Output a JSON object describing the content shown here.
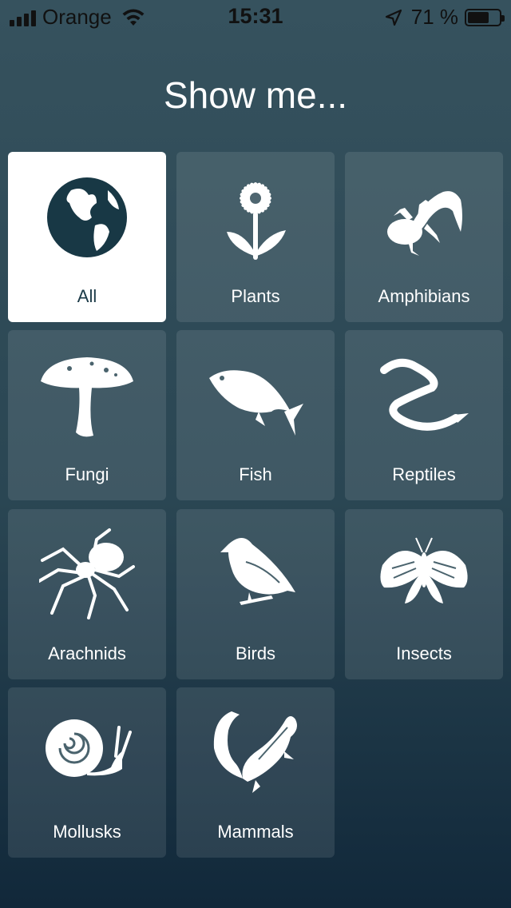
{
  "status_bar": {
    "carrier": "Orange",
    "time": "15:31",
    "battery_percent": "71 %",
    "battery_level": 0.71
  },
  "page": {
    "title": "Show me..."
  },
  "colors": {
    "selected_tile_bg": "#ffffff",
    "icon_selected": "#183845",
    "icon_default": "#ffffff"
  },
  "categories": [
    {
      "label": "All",
      "icon": "globe-icon",
      "selected": true
    },
    {
      "label": "Plants",
      "icon": "flower-icon",
      "selected": false
    },
    {
      "label": "Amphibians",
      "icon": "salamander-icon",
      "selected": false
    },
    {
      "label": "Fungi",
      "icon": "mushroom-icon",
      "selected": false
    },
    {
      "label": "Fish",
      "icon": "fish-icon",
      "selected": false
    },
    {
      "label": "Reptiles",
      "icon": "snake-icon",
      "selected": false
    },
    {
      "label": "Arachnids",
      "icon": "spider-icon",
      "selected": false
    },
    {
      "label": "Birds",
      "icon": "bird-icon",
      "selected": false
    },
    {
      "label": "Insects",
      "icon": "moth-icon",
      "selected": false
    },
    {
      "label": "Mollusks",
      "icon": "snail-icon",
      "selected": false
    },
    {
      "label": "Mammals",
      "icon": "chipmunk-icon",
      "selected": false
    }
  ]
}
